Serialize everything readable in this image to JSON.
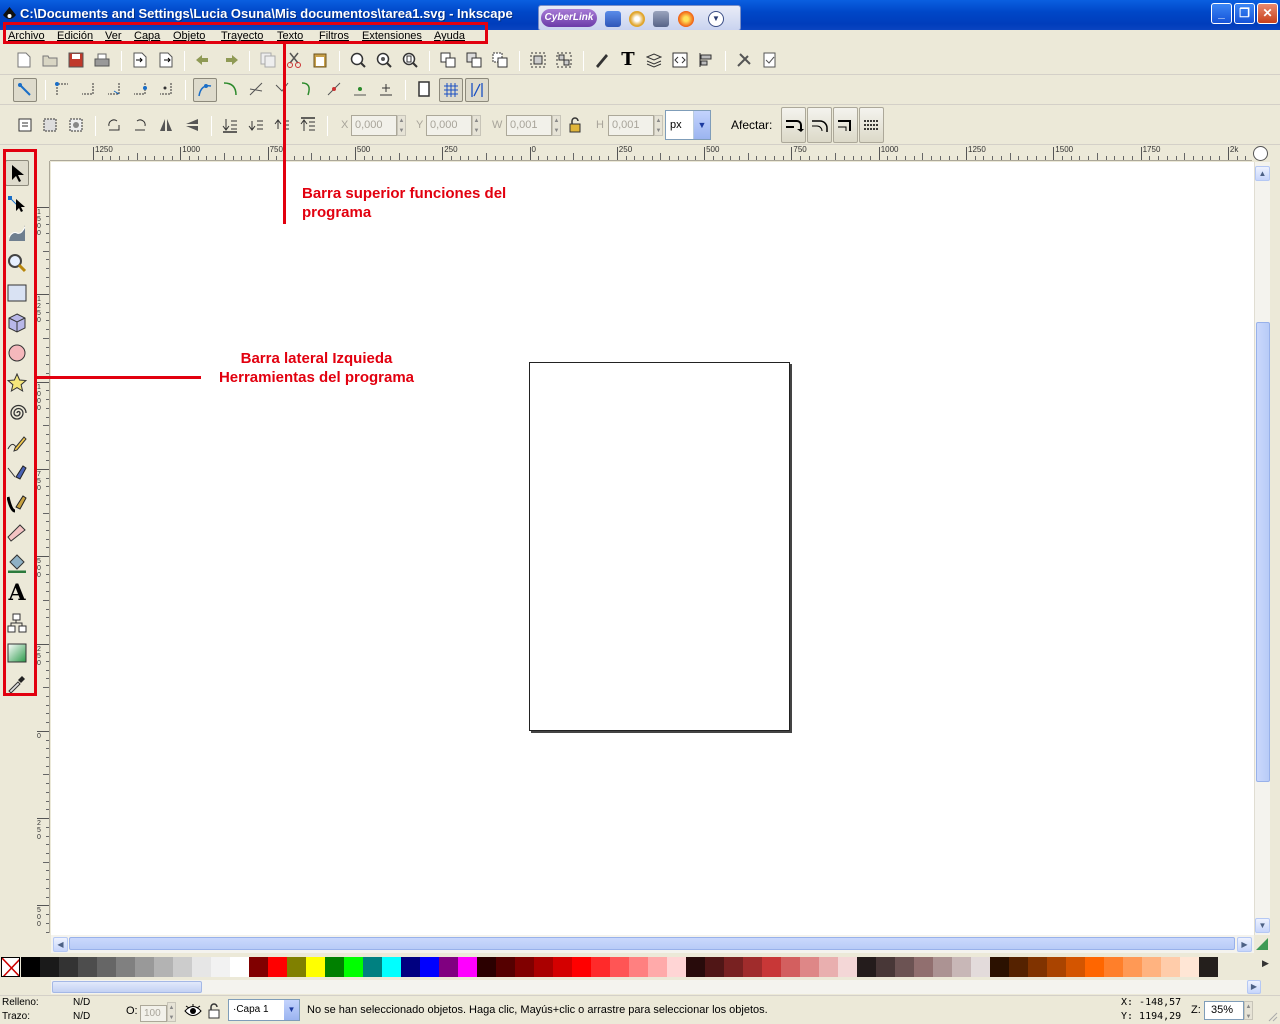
{
  "window": {
    "title": "C:\\Documents and Settings\\Lucia Osuna\\Mis documentos\\tarea1.svg - Inkscape",
    "cyberlink_label": "CyberLink",
    "minimize": "_",
    "maximize": "❐",
    "close": "✕"
  },
  "menu": {
    "items": [
      "Archivo",
      "Edición",
      "Ver",
      "Capa",
      "Objeto",
      "Trayecto",
      "Texto",
      "Filtros",
      "Extensiones",
      "Ayuda"
    ]
  },
  "select_toolbar": {
    "x_label": "X",
    "x_value": "0,000",
    "y_label": "Y",
    "y_value": "0,000",
    "w_label": "W",
    "w_value": "0,001",
    "h_label": "H",
    "h_value": "0,001",
    "unit": "px",
    "affect_label": "Afectar:"
  },
  "rulers": {
    "horizontal_labels": [
      "1250",
      "1000",
      "750",
      "500",
      "250",
      "0",
      "250",
      "500",
      "750",
      "1000",
      "1250",
      "1500",
      "1750",
      "2k"
    ],
    "vertical_labels": [
      "1500",
      "1250",
      "1000",
      "750",
      "500",
      "250",
      "0",
      "250",
      "500"
    ]
  },
  "palette": {
    "colors": [
      "#000000",
      "#1a1a1a",
      "#333333",
      "#4d4d4d",
      "#666666",
      "#808080",
      "#999999",
      "#b3b3b3",
      "#cccccc",
      "#e6e6e6",
      "#f2f2f2",
      "#ffffff",
      "#800000",
      "#ff0000",
      "#808000",
      "#ffff00",
      "#008000",
      "#00ff00",
      "#008080",
      "#00ffff",
      "#000080",
      "#0000ff",
      "#800080",
      "#ff00ff",
      "#2b0000",
      "#550000",
      "#800000",
      "#aa0000",
      "#d40000",
      "#ff0000",
      "#ff2a2a",
      "#ff5555",
      "#ff8080",
      "#ffaaaa",
      "#ffd5d5",
      "#280b0b",
      "#501616",
      "#782121",
      "#a02c2c",
      "#c83737",
      "#d35f5f",
      "#de8787",
      "#e9afaf",
      "#f4d7d7",
      "#241c1c",
      "#483737",
      "#6c5353",
      "#916f6f",
      "#ac9393",
      "#c8b7b7",
      "#e3dbdb",
      "#2b1100",
      "#552200",
      "#803300",
      "#aa4400",
      "#d45500",
      "#ff6600",
      "#ff7f2a",
      "#ff9955",
      "#ffb380",
      "#ffccaa",
      "#ffe6d5",
      "#241f1c"
    ]
  },
  "statusbar": {
    "fill_label": "Relleno:",
    "fill_value": "N/D",
    "stroke_label": "Trazo:",
    "stroke_value": "N/D",
    "opacity_label": "O:",
    "opacity_value": "100",
    "layer": "·Capa 1",
    "message": "No se han seleccionado objetos. Haga clic, Mayús+clic o arrastre para seleccionar los objetos.",
    "coord_x": "X: -148,57",
    "coord_y": "Y: 1194,29",
    "zoom_label": "Z:",
    "zoom_value": "35%"
  },
  "annotations": {
    "top_bar": [
      "Barra superior funciones del",
      "programa"
    ],
    "left_bar": [
      "Barra lateral Izquieda",
      "Herramientas del programa"
    ]
  },
  "accent_colors": {
    "annotation_red": "#e2000f",
    "titlebar_blue": "#0047c8"
  }
}
